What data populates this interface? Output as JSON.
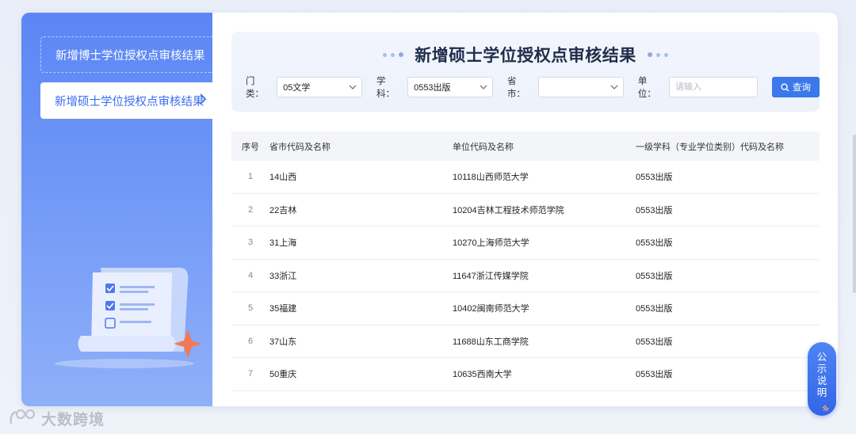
{
  "sidebar": {
    "items": [
      {
        "label": "新增博士学位授权点审核结果"
      },
      {
        "label": "新增硕士学位授权点审核结果"
      }
    ]
  },
  "main": {
    "title": "新增硕士学位授权点审核结果",
    "filters": {
      "category": {
        "label": "门类：",
        "value": "05文学"
      },
      "subject": {
        "label": "学科：",
        "value": "0553出版"
      },
      "province": {
        "label": "省市：",
        "value": ""
      },
      "unit": {
        "label": "单位：",
        "placeholder": "请输入"
      },
      "search_label": "查询"
    },
    "table": {
      "headers": [
        "序号",
        "省市代码及名称",
        "单位代码及名称",
        "一级学科（专业学位类别）代码及名称"
      ],
      "rows": [
        [
          "1",
          "14山西",
          "10118山西师范大学",
          "0553出版"
        ],
        [
          "2",
          "22吉林",
          "10204吉林工程技术师范学院",
          "0553出版"
        ],
        [
          "3",
          "31上海",
          "10270上海师范大学",
          "0553出版"
        ],
        [
          "4",
          "33浙江",
          "11647浙江传媒学院",
          "0553出版"
        ],
        [
          "5",
          "35福建",
          "10402闽南师范大学",
          "0553出版"
        ],
        [
          "6",
          "37山东",
          "11688山东工商学院",
          "0553出版"
        ],
        [
          "7",
          "50重庆",
          "10635西南大学",
          "0553出版"
        ]
      ]
    }
  },
  "notice_button": {
    "chars": [
      "公",
      "示",
      "说",
      "明"
    ]
  },
  "watermark": {
    "text": "大数跨境"
  },
  "colors": {
    "accent": "#3b78ec",
    "sidebar": "#5b86f5"
  }
}
